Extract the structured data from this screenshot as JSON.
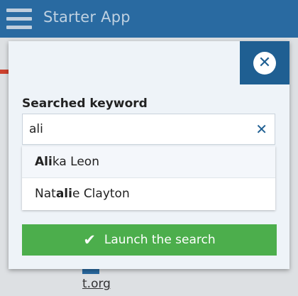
{
  "appbar": {
    "title": "Starter App"
  },
  "background": {
    "link_fragment": "t.org"
  },
  "modal": {
    "close_icon": "close-icon",
    "field_label": "Searched keyword",
    "search": {
      "value": "ali",
      "clear_icon": "clear-icon"
    },
    "suggestions": [
      {
        "match": "Ali",
        "rest": "ka Leon",
        "prefix": ""
      },
      {
        "prefix": "Nat",
        "match": "ali",
        "rest": "e Clayton"
      }
    ],
    "launch_button": {
      "label": "Launch the search",
      "icon": "check-icon"
    }
  },
  "colors": {
    "appbar": "#2a6fa8",
    "close_bg": "#1f5f92",
    "launch_bg": "#4cae4c"
  }
}
